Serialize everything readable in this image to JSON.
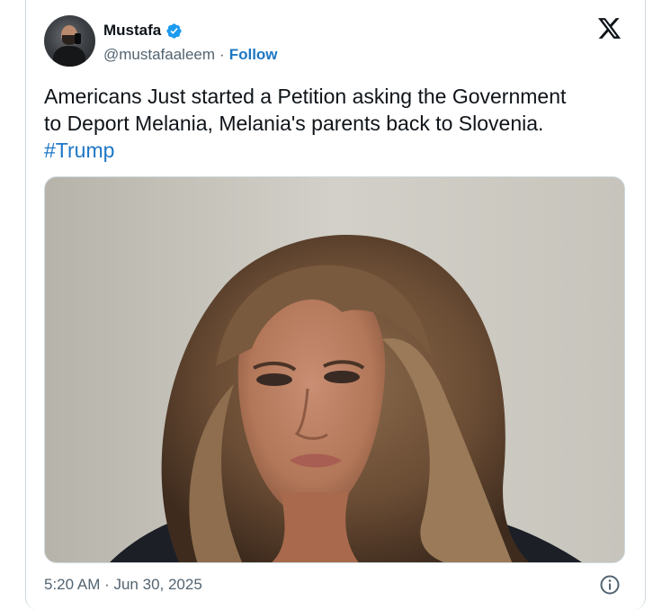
{
  "author": {
    "display_name": "Mustafa",
    "handle": "@mustafaaleem",
    "separator": "·",
    "follow_label": "Follow"
  },
  "tweet": {
    "text_line1": "Americans Just started a Petition asking the Government",
    "text_line2": "to Deport Melania, Melania's parents back to Slovenia.",
    "hashtag": "#Trump",
    "timestamp": "5:20 AM · Jun 30, 2025"
  },
  "icons": {
    "verified": "verified-badge-icon",
    "platform": "x-logo-icon",
    "info": "info-icon"
  },
  "colors": {
    "link": "#1d77c4",
    "secondary_text": "#536471",
    "verified": "#1d9bf0"
  }
}
